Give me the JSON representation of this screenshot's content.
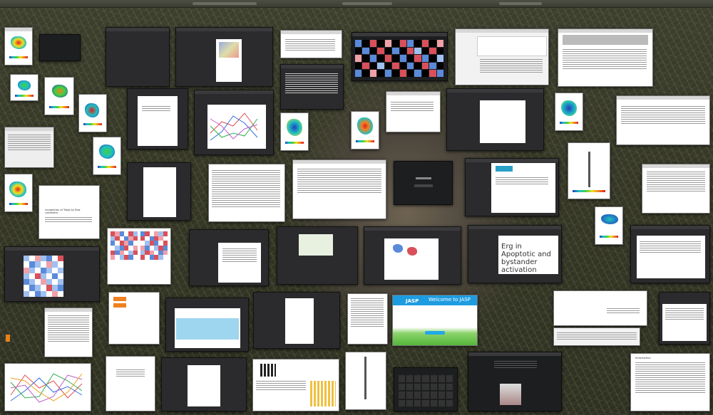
{
  "desktop": {
    "background": "rodent-in-dry-grass-photo"
  },
  "windows": {
    "heading_title": "Erg in Apoptotic and bystander activation",
    "jasp_brand": "JASP",
    "jasp_welcome": "Welcome to JASP",
    "paper_heading": "Introduction",
    "doc_snippet": "recognition of Tregs by flow cytometry",
    "note_snippet": "Arrangement of all open applications"
  },
  "colors": {
    "accent_jasp": "#1e9ce0",
    "heat_red": "#d9505a",
    "heat_blue": "#5a8ad9",
    "flow_hot": "#e02020",
    "flow_cold": "#2040c0"
  }
}
